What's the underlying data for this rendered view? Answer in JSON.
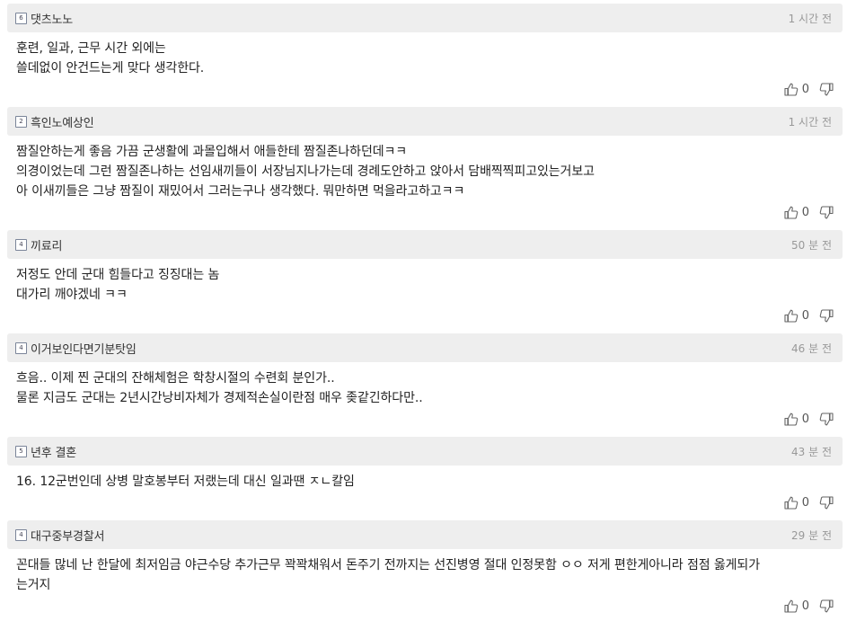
{
  "comments": [
    {
      "level": "6",
      "nick": "댓츠노노",
      "time": "1 시간 전",
      "lines": [
        "훈련, 일과, 근무 시간 외에는",
        "쓸데없이 안건드는게 맞다 생각한다."
      ],
      "up": "0"
    },
    {
      "level": "2",
      "nick": "흑인노예상인",
      "time": "1 시간 전",
      "lines": [
        "짬질안하는게 좋음 가끔 군생활에 과몰입해서 애들한테 짬질존나하던데ㅋㅋ",
        "의경이었는데 그런 짬질존나하는 선임새끼들이 서장님지나가는데 경례도안하고 앉아서 담배찍찍피고있는거보고",
        "아 이새끼들은 그냥 짬질이 재밌어서 그러는구나 생각했다. 뭐만하면 먹을라고하고ㅋㅋ"
      ],
      "up": "0"
    },
    {
      "level": "4",
      "nick": "끼료리",
      "time": "50 분 전",
      "lines": [
        "저정도 안데 군대 힘들다고 징징대는 놈",
        "대가리 깨야겠네 ㅋㅋ"
      ],
      "up": "0"
    },
    {
      "level": "4",
      "nick": "이거보인다면기분탓임",
      "time": "46 분 전",
      "lines": [
        "흐음.. 이제 찐 군대의 잔해체험은 학창시절의 수련회 분인가..",
        "물론 지금도 군대는 2년시간낭비자체가 경제적손실이란점 매우 좆같긴하다만.."
      ],
      "up": "0"
    },
    {
      "level": "5",
      "nick": "년후 결혼",
      "time": "43 분 전",
      "lines": [
        "16. 12군번인데 상병 말호봉부터 저랬는데 대신 일과땐 ㅈㄴ칼임"
      ],
      "up": "0"
    },
    {
      "level": "4",
      "nick": "대구중부경찰서",
      "time": "29 분 전",
      "lines": [
        "꼰대들 많네 난 한달에 최저임금 야근수당 추가근무 꽉꽉채워서 돈주기 전까지는 선진병영 절대 인정못함 ㅇㅇ 저게 편한게아니라 점점 옳게되가",
        "는거지"
      ],
      "up": "0"
    }
  ]
}
